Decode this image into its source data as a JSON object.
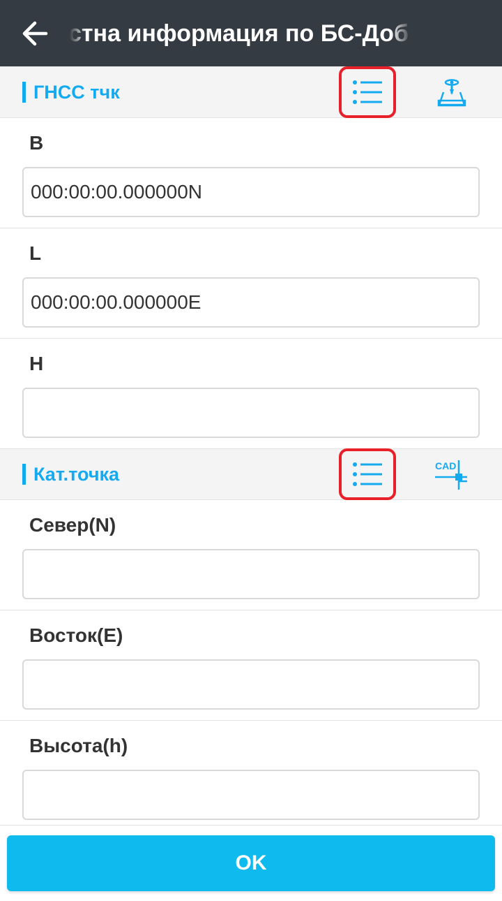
{
  "header": {
    "title": "стна информация по БС-Доб"
  },
  "icons": {
    "back": "arrow-left-icon",
    "list": "list-icon",
    "gnss_point": "gnss-point-icon",
    "cad": "cad-icon"
  },
  "colors": {
    "appbar": "#353b42",
    "accent": "#14aaf0",
    "highlight": "#e8202a",
    "ok_button": "#0fbaee"
  },
  "gnss_section": {
    "title": "ГНСС тчк",
    "fields": [
      {
        "label": "B",
        "value": "000:00:00.000000N"
      },
      {
        "label": "L",
        "value": "000:00:00.000000E"
      },
      {
        "label": "H",
        "value": ""
      }
    ]
  },
  "cad_section": {
    "title": "Кат.точка",
    "cad_badge": "CAD",
    "fields": [
      {
        "label": "Север(N)",
        "value": ""
      },
      {
        "label": "Восток(E)",
        "value": ""
      },
      {
        "label": "Высота(h)",
        "value": ""
      }
    ]
  },
  "ok_button": {
    "label": "OK"
  }
}
